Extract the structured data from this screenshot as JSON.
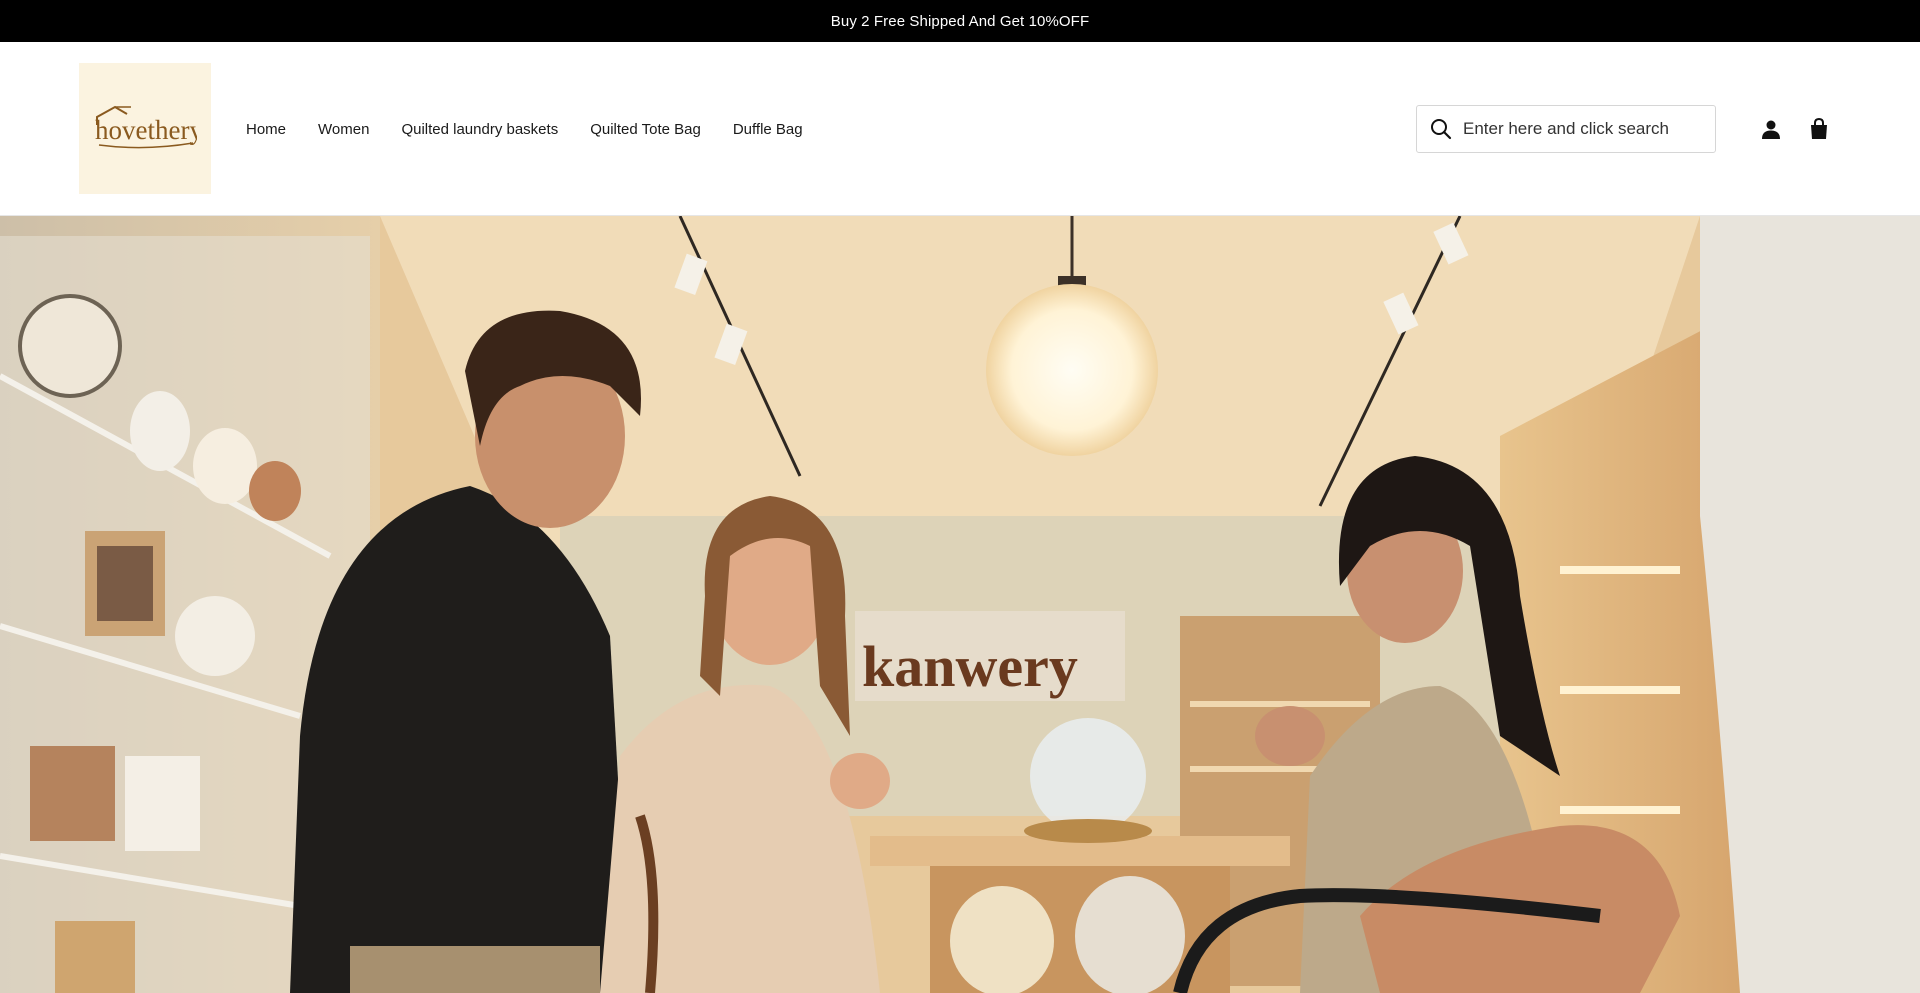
{
  "announcement": {
    "text": "Buy 2 Free Shipped And Get 10%OFF"
  },
  "logo": {
    "text": "hovethery",
    "icon": "house-roof-icon"
  },
  "nav": {
    "items": [
      {
        "label": "Home"
      },
      {
        "label": "Women"
      },
      {
        "label": "Quilted laundry baskets"
      },
      {
        "label": "Quilted Tote Bag"
      },
      {
        "label": "Duffle Bag"
      }
    ]
  },
  "search": {
    "placeholder": "Enter here and click search",
    "icon": "search-icon"
  },
  "header_icons": {
    "account": "user-icon",
    "cart": "shopping-bag-icon"
  },
  "hero": {
    "store_sign": "kanwery",
    "description_icon": "hero-photo"
  },
  "colors": {
    "announcement_bg": "#000000",
    "logo_bg": "#fbf3e0",
    "logo_text": "#8a5a1f"
  }
}
